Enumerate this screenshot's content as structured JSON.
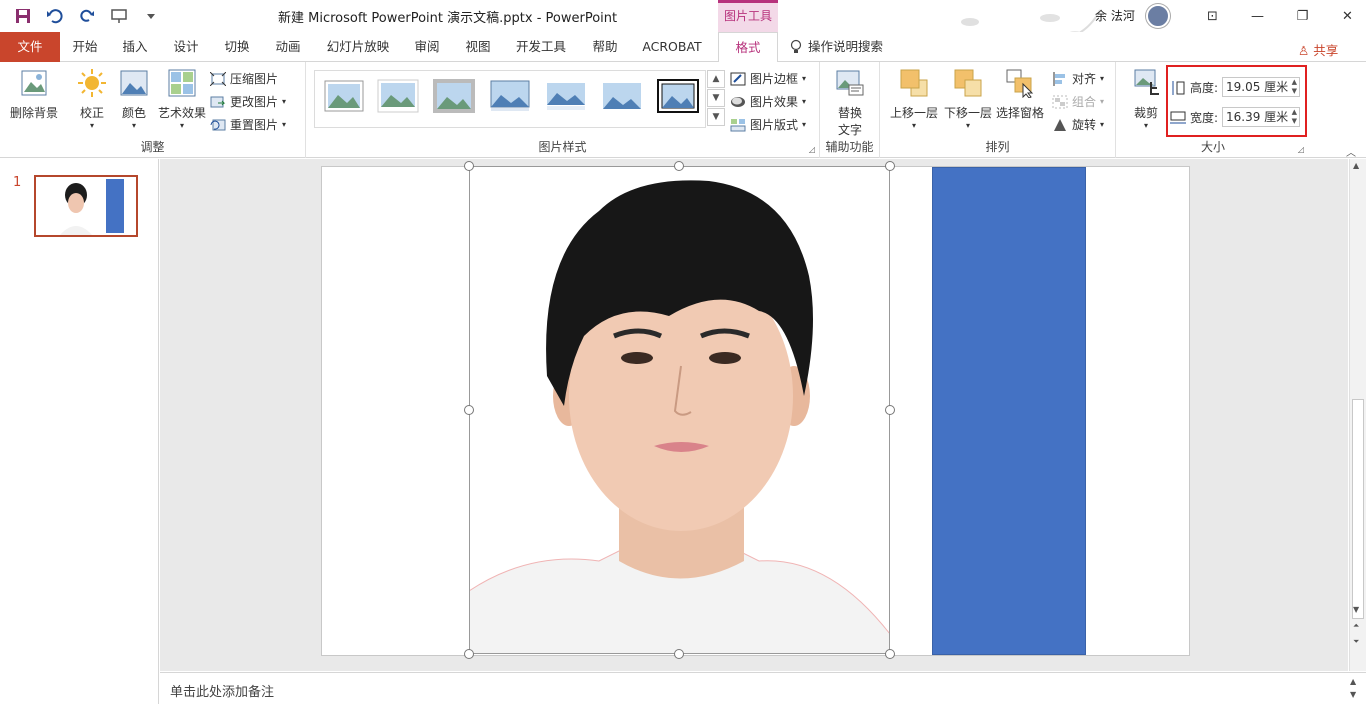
{
  "titlebar": {
    "title": "新建 Microsoft PowerPoint 演示文稿.pptx  -  PowerPoint",
    "context_tab": "图片工具",
    "user": "余 法河",
    "share": "共享"
  },
  "tabs": [
    "文件",
    "开始",
    "插入",
    "设计",
    "切换",
    "动画",
    "幻灯片放映",
    "审阅",
    "视图",
    "开发工具",
    "帮助",
    "ACROBAT",
    "格式"
  ],
  "tell_me": "操作说明搜索",
  "ribbon": {
    "adjust": {
      "label": "调整",
      "remove_bg": "删除背景",
      "correct": "校正",
      "color": "颜色",
      "artistic": "艺术效果",
      "compress": "压缩图片",
      "change": "更改图片",
      "reset": "重置图片"
    },
    "styles": {
      "label": "图片样式",
      "border": "图片边框",
      "effects": "图片效果",
      "layout": "图片版式"
    },
    "accessibility": {
      "label": "辅助功能",
      "alt_text_1": "替换",
      "alt_text_2": "文字"
    },
    "arrange": {
      "label": "排列",
      "bring_forward": "上移一层",
      "send_backward": "下移一层",
      "selection_pane": "选择窗格",
      "align": "对齐",
      "group": "组合",
      "rotate": "旋转"
    },
    "size": {
      "label": "大小",
      "crop": "裁剪",
      "height_label": "高度:",
      "height_value": "19.05 厘米",
      "width_label": "宽度:",
      "width_value": "16.39 厘米"
    }
  },
  "slides": {
    "number": "1"
  },
  "notes": {
    "placeholder": "单击此处添加备注"
  },
  "colors": {
    "file_tab": "#c9452c",
    "accent": "#b7327c",
    "shape_fill": "#4472c4",
    "highlight": "#e02020"
  }
}
